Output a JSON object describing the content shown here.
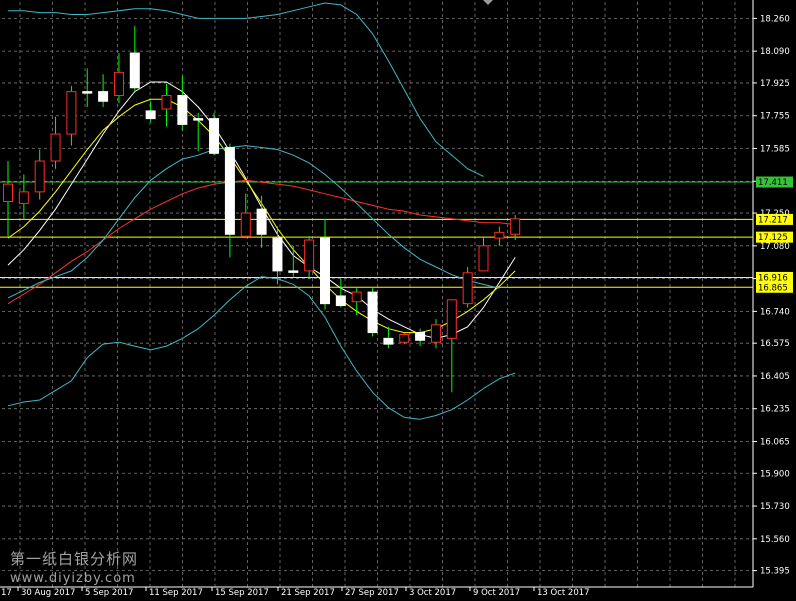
{
  "chart_data": {
    "type": "candlestick",
    "y_axis": {
      "range": [
        15.31,
        18.345
      ],
      "ticks": [
        "18.260",
        "18.090",
        "17.925",
        "17.755",
        "17.585",
        "17.415",
        "17.250",
        "17.080",
        "16.910",
        "16.740",
        "16.575",
        "16.405",
        "16.235",
        "16.065",
        "15.900",
        "15.730",
        "15.560",
        "15.395"
      ],
      "position": "right"
    },
    "x_axis": {
      "ticks": [
        "17",
        "30 Aug 2017",
        "5 Sep 2017",
        "11 Sep 2017",
        "15 Sep 2017",
        "21 Sep 2017",
        "27 Sep 2017",
        "3 Oct 2017",
        "9 Oct 2017",
        "13 Oct 2017"
      ]
    },
    "grid": true,
    "candles": [
      {
        "o": 17.31,
        "h": 17.52,
        "l": 17.13,
        "c": 17.4
      },
      {
        "o": 17.3,
        "h": 17.45,
        "l": 17.22,
        "c": 17.36
      },
      {
        "o": 17.36,
        "h": 17.58,
        "l": 17.32,
        "c": 17.52
      },
      {
        "o": 17.52,
        "h": 17.75,
        "l": 17.48,
        "c": 17.66
      },
      {
        "o": 17.66,
        "h": 17.91,
        "l": 17.6,
        "c": 17.88
      },
      {
        "o": 17.88,
        "h": 18.0,
        "l": 17.8,
        "c": 17.88
      },
      {
        "o": 17.88,
        "h": 17.97,
        "l": 17.8,
        "c": 17.83
      },
      {
        "o": 17.86,
        "h": 18.08,
        "l": 17.82,
        "c": 17.98
      },
      {
        "o": 18.08,
        "h": 18.22,
        "l": 17.88,
        "c": 17.9
      },
      {
        "o": 17.78,
        "h": 17.83,
        "l": 17.72,
        "c": 17.74
      },
      {
        "o": 17.79,
        "h": 17.92,
        "l": 17.7,
        "c": 17.86
      },
      {
        "o": 17.86,
        "h": 17.96,
        "l": 17.68,
        "c": 17.71
      },
      {
        "o": 17.74,
        "h": 17.77,
        "l": 17.57,
        "c": 17.74
      },
      {
        "o": 17.74,
        "h": 17.77,
        "l": 17.55,
        "c": 17.56
      },
      {
        "o": 17.59,
        "h": 17.61,
        "l": 17.02,
        "c": 17.14
      },
      {
        "o": 17.13,
        "h": 17.35,
        "l": 17.12,
        "c": 17.25
      },
      {
        "o": 17.27,
        "h": 17.34,
        "l": 17.07,
        "c": 17.14
      },
      {
        "o": 17.12,
        "h": 17.18,
        "l": 16.88,
        "c": 16.95
      },
      {
        "o": 16.95,
        "h": 17.08,
        "l": 16.92,
        "c": 16.95
      },
      {
        "o": 16.95,
        "h": 17.13,
        "l": 16.91,
        "c": 17.11
      },
      {
        "o": 17.12,
        "h": 17.22,
        "l": 16.75,
        "c": 16.78
      },
      {
        "o": 16.82,
        "h": 16.91,
        "l": 16.76,
        "c": 16.77
      },
      {
        "o": 16.79,
        "h": 16.86,
        "l": 16.72,
        "c": 16.84
      },
      {
        "o": 16.84,
        "h": 16.86,
        "l": 16.61,
        "c": 16.63
      },
      {
        "o": 16.6,
        "h": 16.66,
        "l": 16.55,
        "c": 16.57
      },
      {
        "o": 16.58,
        "h": 16.63,
        "l": 16.57,
        "c": 16.62
      },
      {
        "o": 16.63,
        "h": 16.65,
        "l": 16.56,
        "c": 16.59
      },
      {
        "o": 16.58,
        "h": 16.7,
        "l": 16.55,
        "c": 16.67
      },
      {
        "o": 16.6,
        "h": 16.8,
        "l": 16.32,
        "c": 16.8
      },
      {
        "o": 16.78,
        "h": 16.97,
        "l": 16.76,
        "c": 16.94
      },
      {
        "o": 16.95,
        "h": 17.13,
        "l": 16.95,
        "c": 17.08
      },
      {
        "o": 17.12,
        "h": 17.18,
        "l": 17.08,
        "c": 17.15
      },
      {
        "o": 17.14,
        "h": 17.24,
        "l": 17.11,
        "c": 17.22
      }
    ],
    "lines": [
      {
        "name": "",
        "color": "#ffffff",
        "values": [
          16.98,
          17.06,
          17.16,
          17.27,
          17.4,
          17.53,
          17.66,
          17.78,
          17.88,
          17.93,
          17.93,
          17.88,
          17.8,
          17.7,
          17.57,
          17.43,
          17.28,
          17.14,
          17.03,
          16.97,
          16.92,
          16.86,
          16.82,
          16.75,
          16.7,
          16.66,
          16.62,
          16.6,
          16.62,
          16.66,
          16.76,
          16.89,
          17.02
        ]
      },
      {
        "name": "",
        "color": "#ffff00",
        "values": [
          17.12,
          17.18,
          17.26,
          17.36,
          17.47,
          17.58,
          17.68,
          17.75,
          17.81,
          17.84,
          17.84,
          17.8,
          17.73,
          17.65,
          17.54,
          17.42,
          17.3,
          17.17,
          17.06,
          16.97,
          16.88,
          16.8,
          16.74,
          16.69,
          16.65,
          16.63,
          16.63,
          16.65,
          16.69,
          16.74,
          16.8,
          16.87,
          16.95
        ]
      },
      {
        "name": "",
        "color": "#ff3030",
        "values": [
          16.78,
          16.83,
          16.88,
          16.94,
          17.0,
          17.05,
          17.11,
          17.17,
          17.22,
          17.27,
          17.31,
          17.35,
          17.38,
          17.4,
          17.41,
          17.42,
          17.41,
          17.4,
          17.39,
          17.37,
          17.35,
          17.33,
          17.31,
          17.29,
          17.27,
          17.26,
          17.24,
          17.23,
          17.22,
          17.21,
          17.2,
          17.2,
          17.19
        ]
      },
      {
        "name": "",
        "color": "#3fb8c8",
        "values": [
          18.3,
          18.3,
          18.29,
          18.29,
          18.28,
          18.28,
          18.29,
          18.3,
          18.31,
          18.31,
          18.3,
          18.28,
          18.26,
          18.26,
          18.26,
          18.26,
          18.27,
          18.28,
          18.3,
          18.32,
          18.34,
          18.33,
          18.28,
          18.18,
          18.04,
          17.89,
          17.74,
          17.62,
          17.55,
          17.48,
          17.44,
          null,
          null
        ]
      },
      {
        "name": "",
        "color": "#3fb8c8",
        "values": [
          16.81,
          16.85,
          16.89,
          16.92,
          16.95,
          17.02,
          17.11,
          17.22,
          17.33,
          17.42,
          17.48,
          17.53,
          17.55,
          17.58,
          17.59,
          17.6,
          17.59,
          17.58,
          17.55,
          17.51,
          17.45,
          17.38,
          17.3,
          17.22,
          17.14,
          17.07,
          17.01,
          16.97,
          16.93,
          16.9,
          16.88,
          16.86,
          null
        ]
      },
      {
        "name": "",
        "color": "#3fb8c8",
        "values": [
          16.25,
          16.27,
          16.28,
          16.33,
          16.38,
          16.5,
          16.57,
          16.58,
          16.56,
          16.54,
          16.56,
          16.6,
          16.65,
          16.72,
          16.8,
          16.87,
          16.92,
          16.91,
          16.88,
          16.82,
          16.71,
          16.56,
          16.43,
          16.32,
          16.24,
          16.19,
          16.18,
          16.2,
          16.23,
          16.28,
          16.34,
          16.39,
          16.42
        ]
      }
    ],
    "horizontal_lines": [
      {
        "label": "17.411",
        "color": "#36c236",
        "label_bg": "#36c236"
      },
      {
        "label": "17.217",
        "color": "#ffff00",
        "label_bg": "#ffff00"
      },
      {
        "label": "17.125",
        "color": "#ffff00",
        "label_bg": "#ffff00"
      },
      {
        "label": "16.916",
        "color": "#ffff00",
        "label_bg": "#ffff00"
      },
      {
        "label": "16.865",
        "color": "#ffff00",
        "label_bg": "#ffff00"
      }
    ],
    "colors": {
      "background": "#000000",
      "grid": "#7a7a7a",
      "axis_text": "#ffffff",
      "bull": "#000000",
      "bear": "#ffffff",
      "candle_outline": "#ffffff",
      "wick": "#00ff00",
      "bull_outline": "#ff2a2a"
    }
  },
  "watermark": {
    "line1": "第一纸白银分析网",
    "line2": "www.diyizby.com"
  }
}
